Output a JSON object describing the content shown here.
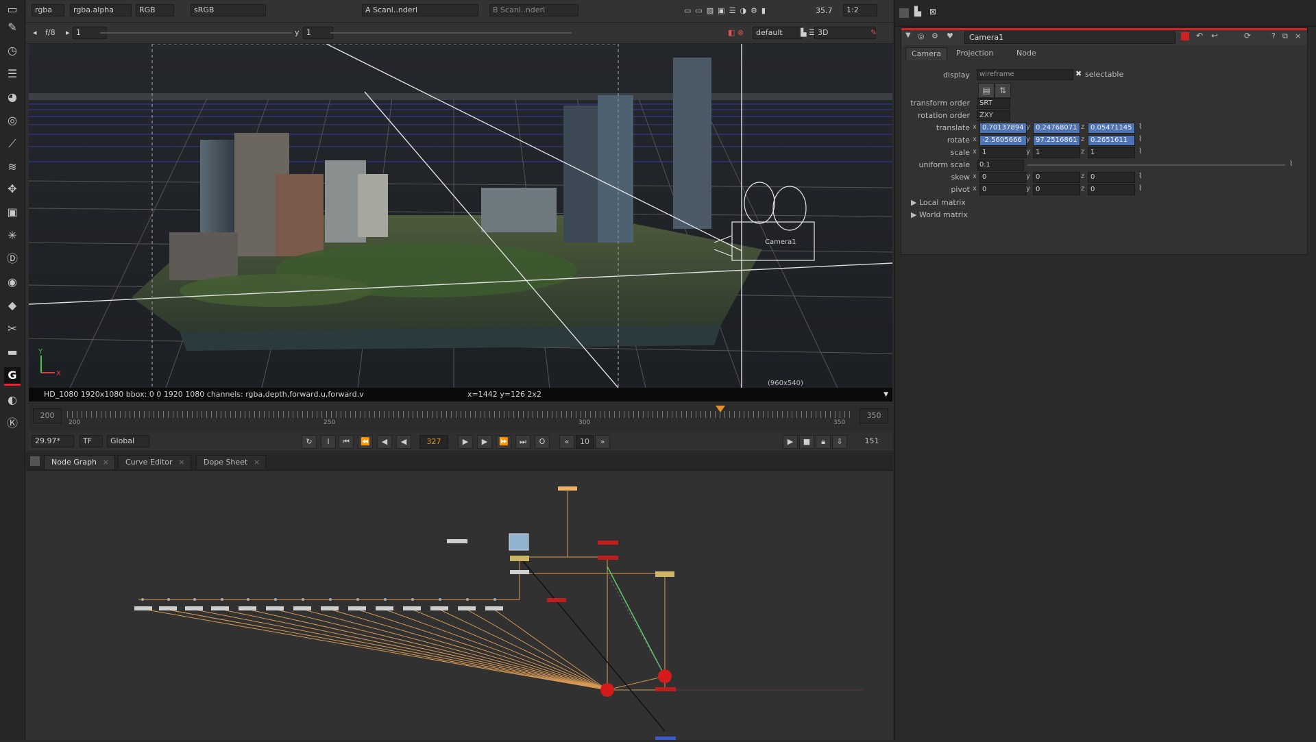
{
  "viewer": {
    "toolbar1": {
      "channels": "rgba",
      "alpha": "rgba.alpha",
      "display": "RGB",
      "lut": "sRGB",
      "input_a": "A  Scanl..nderl",
      "input_b": "B  Scanl..nderl",
      "fps_val": "35.7",
      "zoom": "1:2"
    },
    "toolbar2": {
      "frame_ratio": "f/8",
      "frame_val": "1",
      "y_label": "y",
      "y_val": "1",
      "cam": "default",
      "mode": "3D"
    },
    "info": {
      "format": "HD_1080 1920x1080  bbox: 0 0 1920 1080 channels: rgba,depth,forward.u,forward.v",
      "coords": "x=1442 y=126 2x2",
      "corner": "(960x540)"
    },
    "axis_gizmo": {
      "y": "Y",
      "x": "X"
    },
    "camera_label": "Camera1",
    "timeline": {
      "start": "200",
      "end": "350",
      "ticks": [
        "200",
        "250",
        "300",
        "350"
      ],
      "current": "327"
    },
    "transport": {
      "fps": "29.97*",
      "tf": "TF",
      "global": "Global",
      "frame": "327",
      "step": "10",
      "count": "151"
    }
  },
  "nodegraph": {
    "tabs": [
      {
        "label": "Node Graph"
      },
      {
        "label": "Curve Editor"
      },
      {
        "label": "Dope Sheet"
      }
    ]
  },
  "properties": {
    "node_name": "Camera1",
    "tabs": [
      "Camera",
      "Projection",
      "Node"
    ],
    "display_label": "display",
    "display_value": "wireframe",
    "selectable_label": "selectable",
    "transform_order_label": "transform order",
    "transform_order": "SRT",
    "rotation_order_label": "rotation order",
    "rotation_order": "ZXY",
    "translate_label": "translate",
    "translate": {
      "x": "0.70137894",
      "y": "0.24768071",
      "z": "0.05471145"
    },
    "rotate_label": "rotate",
    "rotate": {
      "x": "-2.5605666",
      "y": "97.2516861",
      "z": "0.2651611"
    },
    "scale_label": "scale",
    "scale": {
      "x": "1",
      "y": "1",
      "z": "1"
    },
    "uniform_scale_label": "uniform scale",
    "uniform_scale": "0.1",
    "skew_label": "skew",
    "skew": {
      "x": "0",
      "y": "0",
      "z": "0"
    },
    "pivot_label": "pivot",
    "pivot": {
      "x": "0",
      "y": "0",
      "z": "0"
    },
    "local_matrix": "Local matrix",
    "world_matrix": "World matrix",
    "axes": {
      "x": "x",
      "y": "y",
      "z": "z"
    }
  },
  "colors": {
    "accent_red": "#d42121",
    "selection_blue": "#4f74b4",
    "timeline_orange": "#e6902a",
    "grid_blue": "#3a3cc8",
    "wire_orange": "#d89a55"
  }
}
